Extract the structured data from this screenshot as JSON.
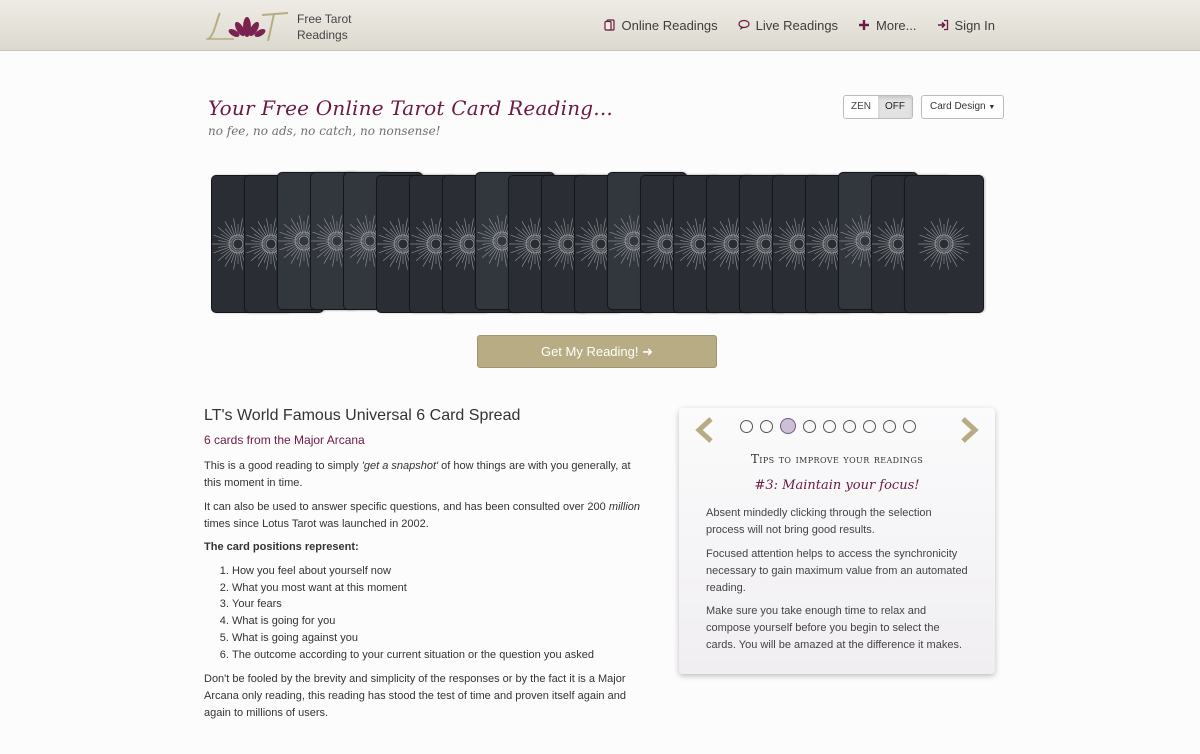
{
  "header": {
    "brand_line1": "Free Tarot",
    "brand_line2": "Readings",
    "nav": [
      {
        "label": "Online Readings",
        "icon": "cards-icon"
      },
      {
        "label": "Live Readings",
        "icon": "chat-icon"
      },
      {
        "label": "More...",
        "icon": "plus-icon"
      },
      {
        "label": "Sign In",
        "icon": "sign-in-icon"
      }
    ]
  },
  "hero": {
    "title": "Your Free Online Tarot Card Reading...",
    "subtitle": "no fee, no ads, no catch, no nonsense!"
  },
  "controls": {
    "zen_label": "ZEN",
    "zen_off_label": "OFF",
    "design_label": "Card Design"
  },
  "deck": {
    "card_count": 22,
    "raised_cards": [
      3,
      4,
      5,
      9,
      13,
      20
    ]
  },
  "cta": {
    "label": "Get My Reading!"
  },
  "reading": {
    "title": "LT's World Famous Universal 6 Card Spread",
    "subtitle": "6 cards from the Major Arcana",
    "p1_a": "This is a good reading to simply ",
    "p1_em": "'get a snapshot'",
    "p1_b": " of how things are with you generally, at this moment in time.",
    "p2_a": "It can also be used to answer specific questions, and has been consulted over 200 ",
    "p2_em": "million",
    "p2_b": " times since Lotus Tarot was launched in 2002.",
    "positions_heading": "The card positions represent:",
    "positions": [
      "How you feel about yourself now",
      "What you most want at this moment",
      "Your fears",
      "What is going for you",
      "What is going against you",
      "The outcome according to your current situation or the question you asked"
    ],
    "p3": "Don't be fooled by the brevity and simplicity of the responses or by the fact it is a Major Arcana only reading, this reading has stood the test of time and proven itself again and again to millions of users."
  },
  "tips": {
    "heading": "Tips to improve your readings",
    "subheading": "#3: Maintain your focus!",
    "dots": 9,
    "active_dot": 3,
    "paragraphs": [
      "Absent mindedly clicking through the selection process will not bring good results.",
      "Focused attention helps to access the synchronicity necessary to gain maximum value from an automated reading.",
      "Make sure you take enough time to relax and compose yourself before you begin to select the cards. You will be amazed at the difference it makes."
    ]
  },
  "colors": {
    "accent": "#6b1a44",
    "gold": "#b7ac83",
    "card_back": "#2a2d33"
  }
}
